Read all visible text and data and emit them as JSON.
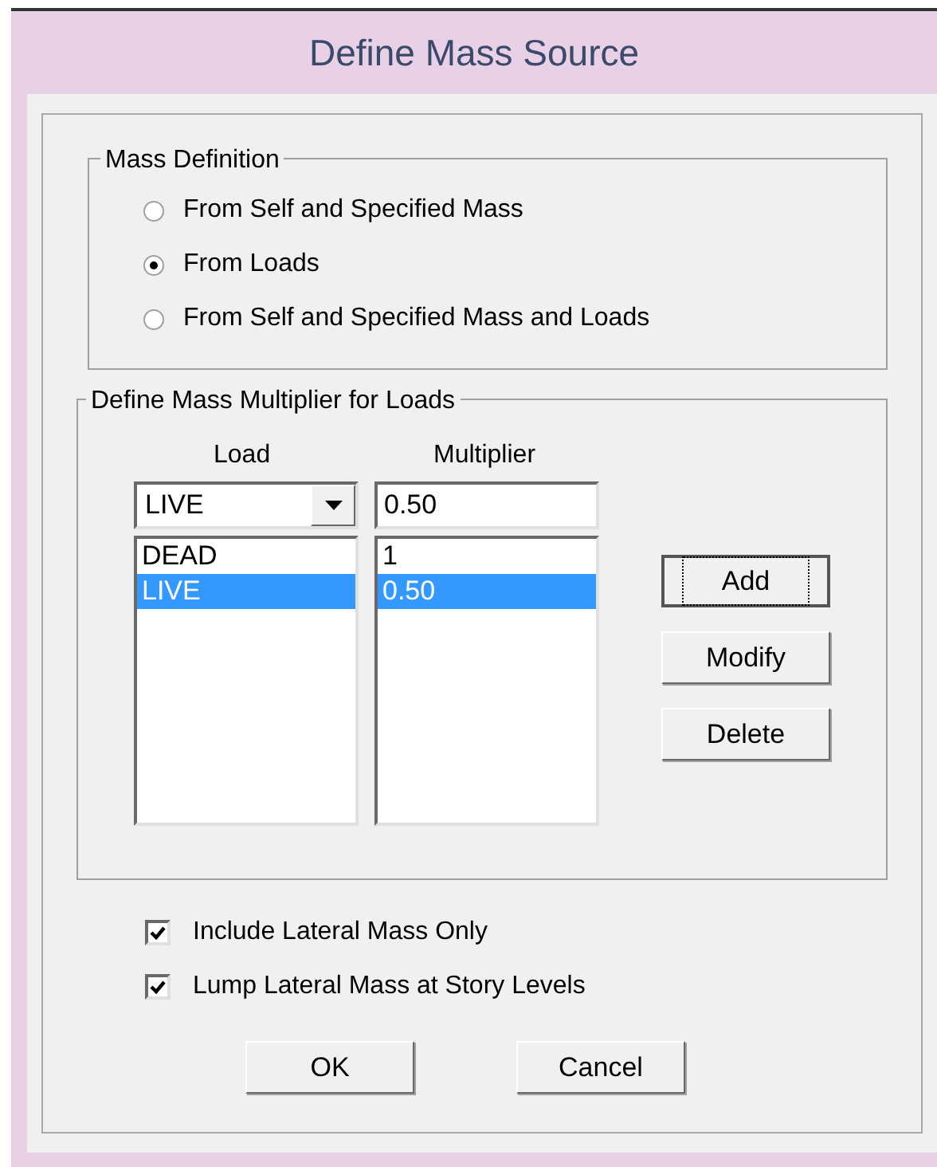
{
  "window": {
    "title": "Define Mass Source"
  },
  "mass_definition": {
    "title": "Mass Definition",
    "options": [
      {
        "label": "From Self and Specified Mass",
        "selected": false
      },
      {
        "label": "From Loads",
        "selected": true
      },
      {
        "label": "From Self and Specified Mass and Loads",
        "selected": false
      }
    ]
  },
  "multipliers": {
    "title": "Define Mass Multiplier for Loads",
    "load_header": "Load",
    "multiplier_header": "Multiplier",
    "load_combo": {
      "value": "LIVE"
    },
    "multiplier_field": {
      "value": "0.50"
    },
    "rows": [
      {
        "load": "DEAD",
        "multiplier": "1",
        "selected": false
      },
      {
        "load": "LIVE",
        "multiplier": "0.50",
        "selected": true
      }
    ],
    "buttons": [
      {
        "label": "Add",
        "focused": true
      },
      {
        "label": "Modify",
        "focused": false
      },
      {
        "label": "Delete",
        "focused": false
      }
    ]
  },
  "options": [
    {
      "label": "Include Lateral Mass Only",
      "checked": true
    },
    {
      "label": "Lump Lateral Mass at Story Levels",
      "checked": true
    }
  ],
  "buttons": [
    {
      "label": "OK"
    },
    {
      "label": "Cancel"
    }
  ]
}
